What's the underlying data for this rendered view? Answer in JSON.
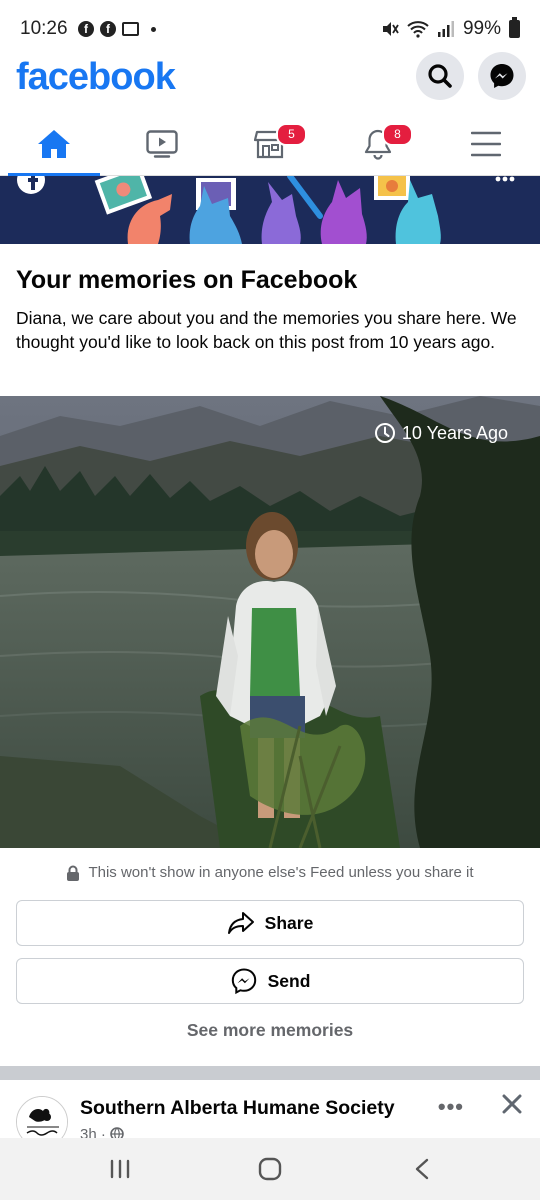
{
  "status_bar": {
    "time": "10:26",
    "battery": "99%"
  },
  "header": {
    "logo": "facebook",
    "brand_color": "#1877f2",
    "search_icon": "search-icon",
    "messenger_icon": "messenger-icon"
  },
  "tabs": [
    {
      "name": "home",
      "icon": "home-icon",
      "active": true
    },
    {
      "name": "watch",
      "icon": "video-icon"
    },
    {
      "name": "marketplace",
      "icon": "store-icon",
      "badge": "5"
    },
    {
      "name": "notifications",
      "icon": "bell-icon",
      "badge": "8"
    },
    {
      "name": "menu",
      "icon": "hamburger-icon"
    }
  ],
  "memory": {
    "title": "Your memories on Facebook",
    "description": "Diana, we care about you and the memories you share here. We thought you'd like to look back on this post from 10 years ago.",
    "time_badge": "10 Years Ago",
    "privacy_note": "This won't show in anyone else's Feed unless you share it",
    "share_label": "Share",
    "send_label": "Send",
    "see_more": "See more memories"
  },
  "next_post": {
    "author": "Southern Alberta Humane Society",
    "time": "3h ·"
  }
}
